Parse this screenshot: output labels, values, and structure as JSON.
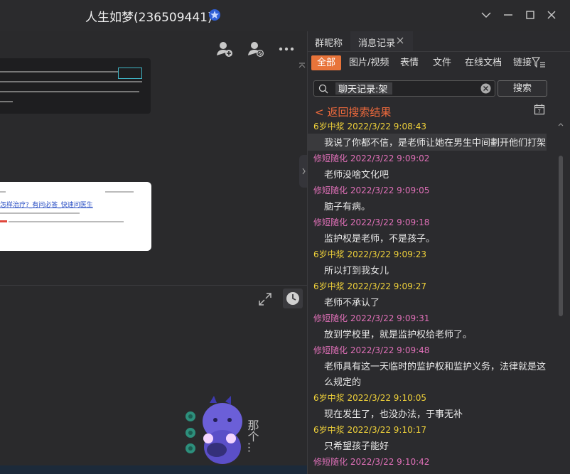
{
  "window": {
    "title": "人生如梦(236509441)",
    "accent": "#2f5fd6"
  },
  "right_panel": {
    "tabs": [
      {
        "label": "群昵称"
      },
      {
        "label": "消息记录"
      }
    ],
    "filters": [
      "全部",
      "图片/视频",
      "表情",
      "文件",
      "在线文档",
      "链接"
    ],
    "search": {
      "value": "聊天记录:架",
      "button": "搜索"
    },
    "back_label": "< 返回搜索结果",
    "name_colors": {
      "6岁中浆": "#f0d23a",
      "修短随化": "#e070b8"
    },
    "records": [
      {
        "sender": "6岁中浆",
        "time": "2022/3/22 9:08:43",
        "text": "我说了你都不信，是老师让她在男生中间劃开他们打架",
        "highlight": true
      },
      {
        "sender": "修短随化",
        "time": "2022/3/22 9:09:02",
        "text": "老师没啥文化吧"
      },
      {
        "sender": "修短随化",
        "time": "2022/3/22 9:09:05",
        "text": "脑子有病。"
      },
      {
        "sender": "修短随化",
        "time": "2022/3/22 9:09:18",
        "text": "监护权是老师，不是孩子。"
      },
      {
        "sender": "6岁中浆",
        "time": "2022/3/22 9:09:23",
        "text": "所以打到我女儿"
      },
      {
        "sender": "6岁中浆",
        "time": "2022/3/22 9:09:27",
        "text": "老师不承认了"
      },
      {
        "sender": "修短随化",
        "time": "2022/3/22 9:09:31",
        "text": "放到学校里，就是监护权给老师了。"
      },
      {
        "sender": "修短随化",
        "time": "2022/3/22 9:09:48",
        "text": "老师具有这一天临时的监护权和监护义务，法律就是这么规定的"
      },
      {
        "sender": "6岁中浆",
        "time": "2022/3/22 9:10:05",
        "text": "现在发生了，也没办法，于事无补"
      },
      {
        "sender": "6岁中浆",
        "time": "2022/3/22 9:10:17",
        "text": "只希望孩子能好"
      },
      {
        "sender": "修短随化",
        "time": "2022/3/22 9:10:42",
        "text": ""
      }
    ]
  },
  "chat": {
    "image2_link": "怎样治疗?_有问必答_快速问医生",
    "sticker_text": "那个..."
  }
}
